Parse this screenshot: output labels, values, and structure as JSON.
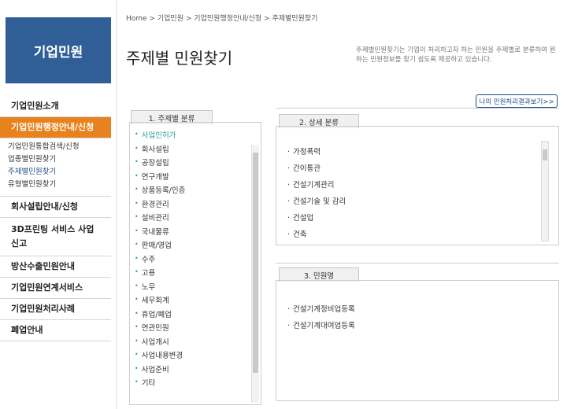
{
  "logo": {
    "text": "기업민원"
  },
  "breadcrumb": [
    "Home",
    "기업민원",
    "기업민원행정안내/신청",
    "주제별민원찾기"
  ],
  "breadcrumb_sep": ">",
  "page": {
    "title": "주제별 민원찾기",
    "desc": "주제별민원찾기는 기업이 처리하고자 하는 민원을 주제별로 분류하여 원하는 민원정보를 찾기 쉽도록 제공하고 있습니다.",
    "result_button": "나의 민원처리결과보기>>"
  },
  "sidebar": {
    "items": [
      {
        "label": "기업민원소개"
      },
      {
        "label": "기업민원행정안내/신청"
      },
      {
        "label": "회사설립안내/신청"
      },
      {
        "label": "3D프린팅 서비스 사업 신고"
      },
      {
        "label": "방산수출민원안내"
      },
      {
        "label": "기업민원연계서비스"
      },
      {
        "label": "기업민원처리사례"
      },
      {
        "label": "폐업안내"
      }
    ],
    "sub_items": [
      "기업민원통합검색/신청",
      "업종별민원찾기",
      "주제별민원찾기",
      "유형별민원찾기"
    ]
  },
  "panel1": {
    "tab": "1. 주제별 분류",
    "items": [
      "사업인허가",
      "회사설립",
      "공장설립",
      "연구개발",
      "상품등록/인증",
      "환경관리",
      "설비관리",
      "국내물류",
      "판매/영업",
      "수주",
      "고용",
      "노무",
      "세무회계",
      "휴업/폐업",
      "연관민원",
      "사업개시",
      "사업내용변경",
      "사업준비",
      "기타"
    ]
  },
  "panel2": {
    "tab": "2. 상세 분류",
    "items": [
      "가정폭력",
      "간이통관",
      "건설기계관리",
      "건설기술 및 감리",
      "건설업",
      "건축"
    ]
  },
  "panel3": {
    "tab": "3. 민원명",
    "items": [
      "건설기계정비업등록",
      "건설기계대여업등록"
    ]
  },
  "colors": {
    "brand": "#2f5f96",
    "active": "#e8821e",
    "accent": "#2a9d8f"
  }
}
